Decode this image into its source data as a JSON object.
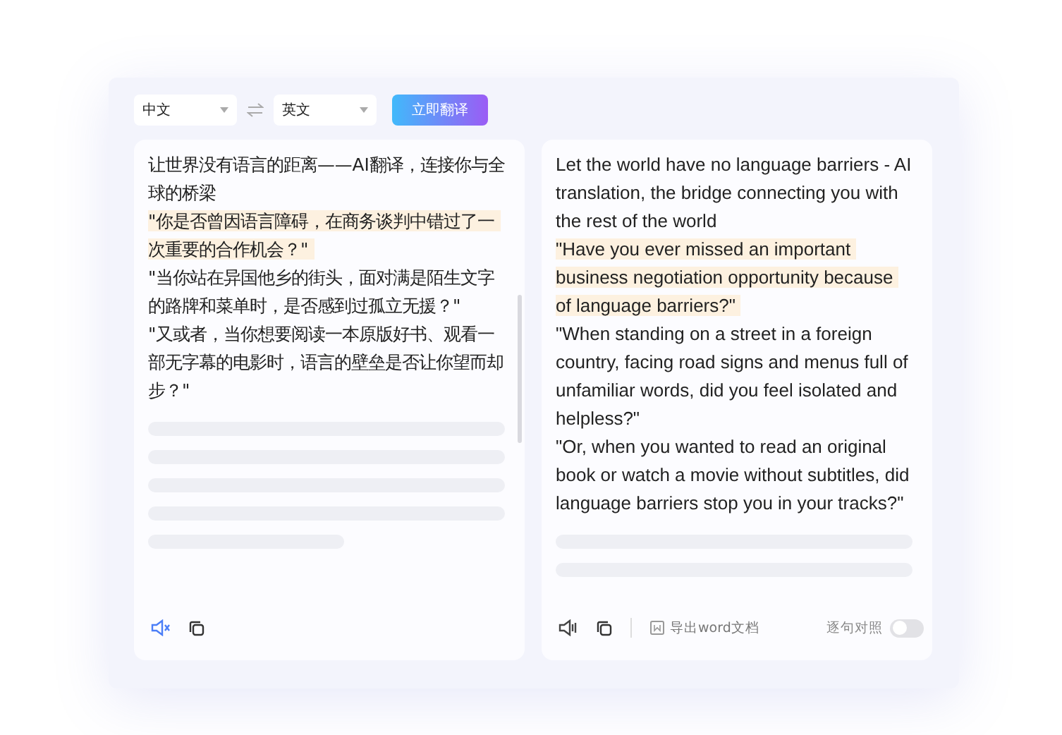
{
  "toolbar": {
    "source_language": "中文",
    "target_language": "英文",
    "translate_button": "立即翻译"
  },
  "source_panel": {
    "paragraphs": [
      {
        "text": "让世界没有语言的距离——AI翻译，连接你与全球的桥梁",
        "highlighted": false
      },
      {
        "text": "\"你是否曾因语言障碍，在商务谈判中错过了一次重要的合作机会？\"",
        "highlighted": true
      },
      {
        "text": "\"当你站在异国他乡的街头，面对满是陌生文字的路牌和菜单时，是否感到过孤立无援？\"",
        "highlighted": false
      },
      {
        "text": "\"又或者，当你想要阅读一本原版好书、观看一部无字幕的电影时，语言的壁垒是否让你望而却步？\"",
        "highlighted": false
      }
    ],
    "speaker_active": true
  },
  "target_panel": {
    "paragraphs": [
      {
        "text": "Let the world have no language barriers - AI translation, the bridge connecting you with the rest of the world",
        "highlighted": false
      },
      {
        "text": "\"Have you ever missed an important business negotiation opportunity because of language barriers?\"",
        "highlighted": true
      },
      {
        "text": "\"When standing on a street in a foreign country, facing road signs and menus full of unfamiliar words, did you feel isolated and helpless?\"",
        "highlighted": false
      },
      {
        "text": "\"Or, when you wanted to read an original book or watch a movie without subtitles, did language barriers stop you in your tracks?\"",
        "highlighted": false
      }
    ],
    "speaker_active": false,
    "export_button": "导出word文档",
    "compare_toggle": {
      "label": "逐句对照",
      "on": false
    }
  }
}
